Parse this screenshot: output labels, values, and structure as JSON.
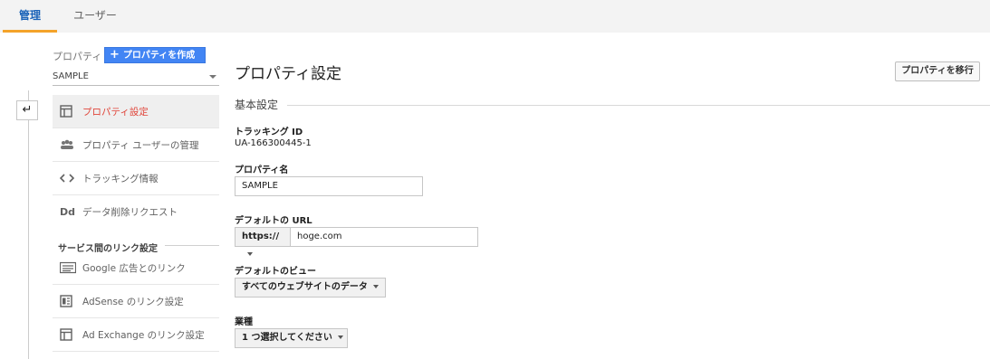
{
  "tabs": [
    {
      "label": "管理",
      "active": true
    },
    {
      "label": "ユーザー",
      "active": false
    }
  ],
  "sidebar": {
    "property_label": "プロパティ",
    "create_button": "プロパティを作成",
    "selected_property": "SAMPLE",
    "items": [
      {
        "label": "プロパティ設定",
        "icon": "layout-icon",
        "active": true
      },
      {
        "label": "プロパティ ユーザーの管理",
        "icon": "users-icon",
        "active": false
      },
      {
        "label": "トラッキング情報",
        "icon": "code-icon",
        "active": false
      },
      {
        "label": "データ削除リクエスト",
        "icon": "dd-icon",
        "active": false
      }
    ],
    "section_title": "サービス間のリンク設定",
    "link_items": [
      {
        "label": "Google 広告とのリンク",
        "icon": "ads-icon"
      },
      {
        "label": "AdSense のリンク設定",
        "icon": "adsense-icon"
      },
      {
        "label": "Ad Exchange のリンク設定",
        "icon": "adexchange-icon"
      }
    ]
  },
  "main": {
    "title": "プロパティ設定",
    "move_button": "プロパティを移行",
    "section_title": "基本設定",
    "tracking_id_label": "トラッキング ID",
    "tracking_id_value": "UA-166300445-1",
    "property_name_label": "プロパティ名",
    "property_name_value": "SAMPLE",
    "default_url_label": "デフォルトの URL",
    "url_protocol": "https://",
    "url_value": "hoge.com",
    "default_view_label": "デフォルトのビュー",
    "default_view_value": "すべてのウェブサイトのデータ",
    "industry_label": "業種",
    "industry_value": "1 つ選択してください"
  },
  "colors": {
    "accent_tab": "#f4a32a",
    "create_button": "#4285f4",
    "active_item_text": "#e0463b"
  }
}
